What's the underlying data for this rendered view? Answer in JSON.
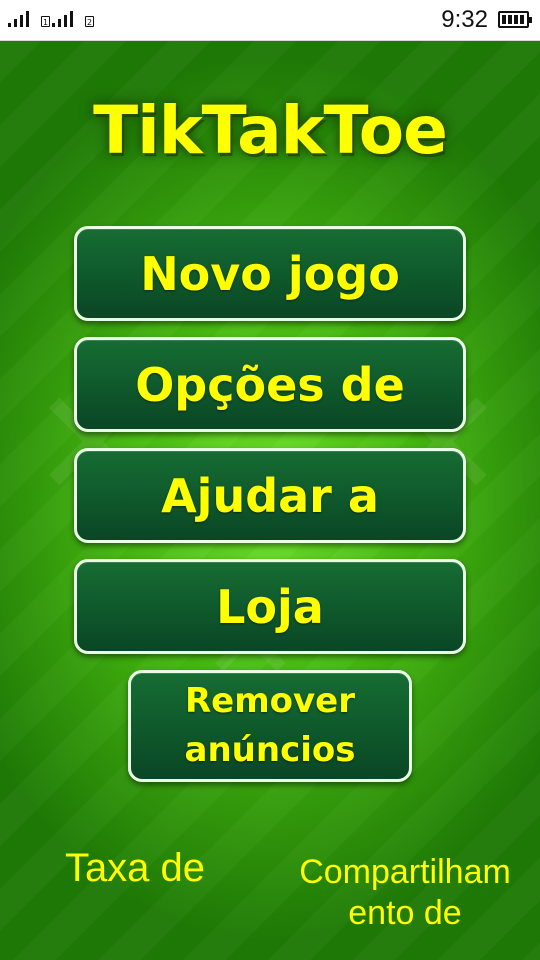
{
  "status_bar": {
    "time": "9:32",
    "sim1_label": "1",
    "sim2_label": "2"
  },
  "app": {
    "title": "TikTakToe"
  },
  "menu": {
    "new_game": "Novo jogo",
    "options": "Opções de",
    "help": "Ajudar a",
    "store": "Loja",
    "remove_ads_line1": "Remover",
    "remove_ads_line2": "anúncios"
  },
  "footer": {
    "rate": "Taxa de",
    "share_line1": "Compartilham",
    "share_line2": "ento de"
  },
  "colors": {
    "background_green": "#45b70f",
    "button_dark_green": "#0f5a2c",
    "text_yellow": "#ffff00",
    "status_bar_bg": "#ffffff"
  },
  "icons": [
    "signal-icon",
    "sim-card-icon",
    "battery-icon"
  ]
}
